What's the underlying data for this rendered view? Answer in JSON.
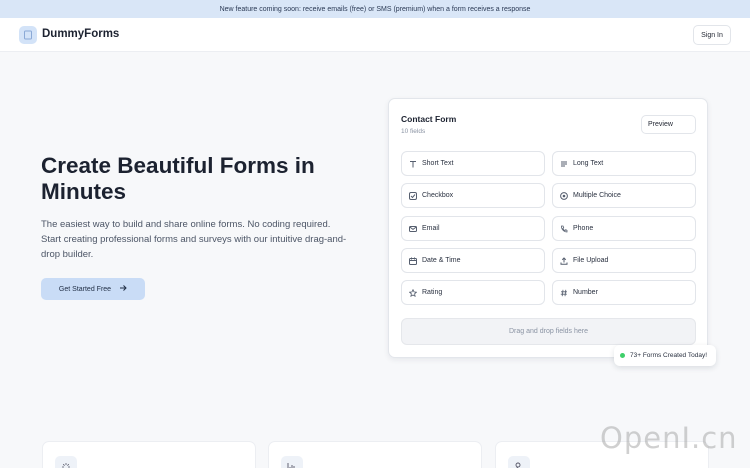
{
  "announcement": "New feature coming soon: receive emails (free) or SMS (premium) when a form receives a response",
  "nav": {
    "brand": "DummyForms",
    "signin_label": "Sign In"
  },
  "hero": {
    "title": "Create Beautiful Forms in Minutes",
    "subtitle": "The easiest way to build and share online forms. No coding required. Start creating professional forms and surveys with our intuitive drag-and-drop builder.",
    "cta_label": "Get Started Free"
  },
  "form_card": {
    "title": "Contact Form",
    "field_count": "10 fields",
    "preview_label": "Preview",
    "fields": [
      {
        "label": "Short Text",
        "icon": "text-icon"
      },
      {
        "label": "Long Text",
        "icon": "paragraph-icon"
      },
      {
        "label": "Checkbox",
        "icon": "checkbox-icon"
      },
      {
        "label": "Multiple Choice",
        "icon": "radio-icon"
      },
      {
        "label": "Email",
        "icon": "mail-icon"
      },
      {
        "label": "Phone",
        "icon": "phone-icon"
      },
      {
        "label": "Date & Time",
        "icon": "calendar-icon"
      },
      {
        "label": "File Upload",
        "icon": "upload-icon"
      },
      {
        "label": "Rating",
        "icon": "star-icon"
      },
      {
        "label": "Number",
        "icon": "hash-icon"
      }
    ],
    "dropzone_label": "Drag and drop fields here"
  },
  "badge": {
    "label": "73+ Forms Created Today!",
    "dot_color": "#3fcf6a"
  },
  "features": [
    {
      "icon": "sparkle-icon"
    },
    {
      "icon": "chart-icon"
    },
    {
      "icon": "user-settings-icon"
    }
  ],
  "watermark": "OpenI.cn",
  "colors": {
    "accent": "#c9dcf6",
    "announcement_bg": "#d9e6f7",
    "page_bg": "#f7f8fa"
  }
}
